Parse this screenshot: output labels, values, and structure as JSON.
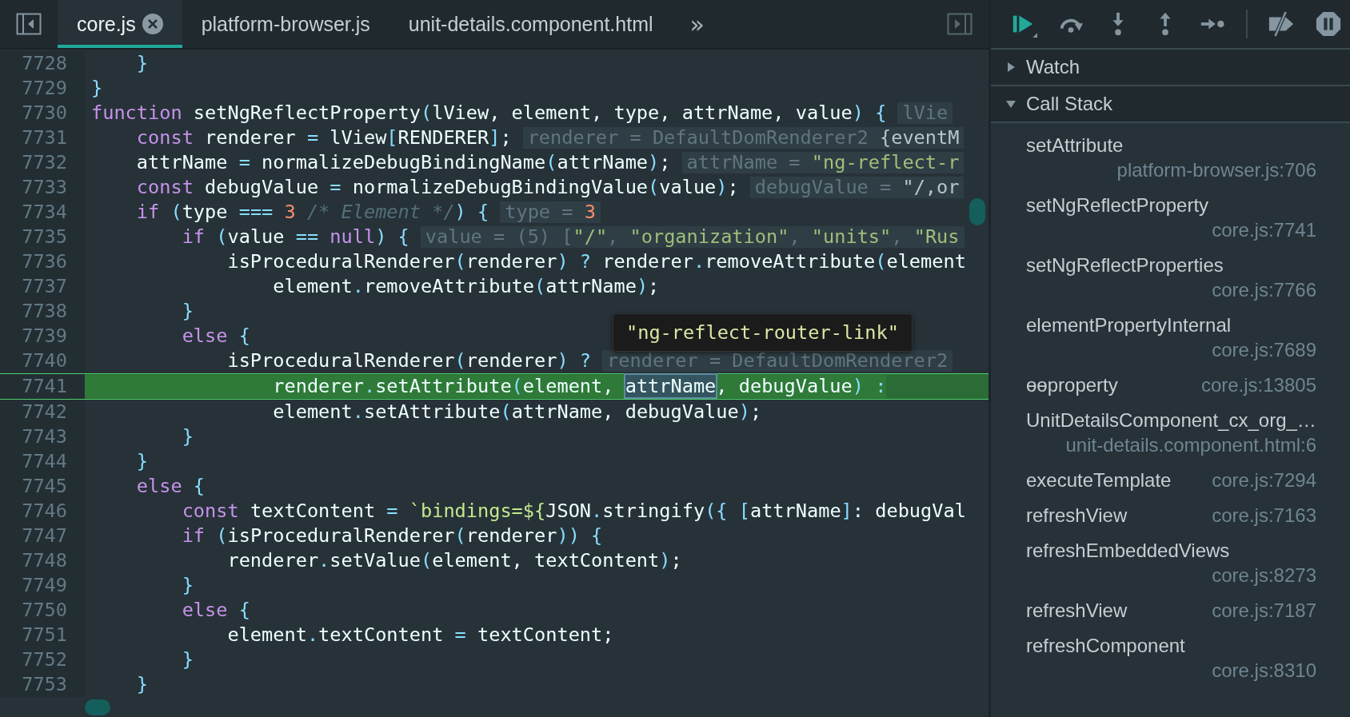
{
  "tabs": [
    {
      "label": "core.js",
      "selected": true,
      "closable": true
    },
    {
      "label": "platform-browser.js",
      "selected": false,
      "closable": false
    },
    {
      "label": "unit-details.component.html",
      "selected": false,
      "closable": false
    }
  ],
  "tabs_overflow": "»",
  "code": {
    "lines": [
      {
        "number": "7728",
        "current": false,
        "tokens": [
          {
            "kind": "punct",
            "text": "    }"
          }
        ]
      },
      {
        "number": "7729",
        "current": false,
        "tokens": [
          {
            "kind": "punct",
            "text": "}"
          }
        ]
      },
      {
        "number": "7730",
        "current": false,
        "tokens": [
          {
            "kind": "keyword",
            "text": "function"
          },
          {
            "kind": "plain",
            "text": " setNgReflectProperty"
          },
          {
            "kind": "punct",
            "text": "("
          },
          {
            "kind": "plain",
            "text": "lView, element, type, attrName, value"
          },
          {
            "kind": "punct",
            "text": ")"
          },
          {
            "kind": "punct",
            "text": " {"
          }
        ],
        "hint": [
          {
            "kind": "hint",
            "text": "lVie"
          }
        ]
      },
      {
        "number": "7731",
        "current": false,
        "tokens": [
          {
            "kind": "keyword",
            "text": "    const"
          },
          {
            "kind": "plain",
            "text": " renderer "
          },
          {
            "kind": "punct",
            "text": "="
          },
          {
            "kind": "plain",
            "text": " lView"
          },
          {
            "kind": "punct",
            "text": "["
          },
          {
            "kind": "plain",
            "text": "RENDERER"
          },
          {
            "kind": "punct",
            "text": "]"
          },
          {
            "kind": "plain",
            "text": ";"
          }
        ],
        "hint": [
          {
            "kind": "hint",
            "text": "renderer = DefaultDomRenderer2 "
          },
          {
            "kind": "plain",
            "text": "{eventM"
          }
        ]
      },
      {
        "number": "7732",
        "current": false,
        "tokens": [
          {
            "kind": "plain",
            "text": "    attrName "
          },
          {
            "kind": "punct",
            "text": "="
          },
          {
            "kind": "plain",
            "text": " normalizeDebugBindingName"
          },
          {
            "kind": "punct",
            "text": "("
          },
          {
            "kind": "plain",
            "text": "attrName"
          },
          {
            "kind": "punct",
            "text": ")"
          },
          {
            "kind": "plain",
            "text": ";"
          }
        ],
        "hint": [
          {
            "kind": "hint",
            "text": "attrName = "
          },
          {
            "kind": "string",
            "text": "\"ng-reflect-r"
          }
        ]
      },
      {
        "number": "7733",
        "current": false,
        "tokens": [
          {
            "kind": "keyword",
            "text": "    const"
          },
          {
            "kind": "plain",
            "text": " debugValue "
          },
          {
            "kind": "punct",
            "text": "="
          },
          {
            "kind": "plain",
            "text": " normalizeDebugBindingValue"
          },
          {
            "kind": "punct",
            "text": "("
          },
          {
            "kind": "plain",
            "text": "value"
          },
          {
            "kind": "punct",
            "text": ")"
          },
          {
            "kind": "plain",
            "text": ";"
          }
        ],
        "hint": [
          {
            "kind": "hint",
            "text": "debugValue = "
          },
          {
            "kind": "plain",
            "text": "\"/,or"
          }
        ]
      },
      {
        "number": "7734",
        "current": false,
        "tokens": [
          {
            "kind": "keyword",
            "text": "    if"
          },
          {
            "kind": "punct",
            "text": " ("
          },
          {
            "kind": "plain",
            "text": "type "
          },
          {
            "kind": "punct",
            "text": "==="
          },
          {
            "kind": "number",
            "text": " 3"
          },
          {
            "kind": "comment",
            "text": " /* Element */"
          },
          {
            "kind": "punct",
            "text": ")"
          },
          {
            "kind": "punct",
            "text": " {"
          }
        ],
        "hint": [
          {
            "kind": "hint",
            "text": "type = "
          },
          {
            "kind": "number",
            "text": "3"
          }
        ]
      },
      {
        "number": "7735",
        "current": false,
        "tokens": [
          {
            "kind": "keyword",
            "text": "        if"
          },
          {
            "kind": "punct",
            "text": " ("
          },
          {
            "kind": "plain",
            "text": "value "
          },
          {
            "kind": "punct",
            "text": "=="
          },
          {
            "kind": "keyword",
            "text": " null"
          },
          {
            "kind": "punct",
            "text": ")"
          },
          {
            "kind": "punct",
            "text": " {"
          }
        ],
        "hint": [
          {
            "kind": "hint",
            "text": "value = (5) ["
          },
          {
            "kind": "string",
            "text": "\"/\""
          },
          {
            "kind": "hint",
            "text": ", "
          },
          {
            "kind": "string",
            "text": "\"organization\""
          },
          {
            "kind": "hint",
            "text": ", "
          },
          {
            "kind": "string",
            "text": "\"units\""
          },
          {
            "kind": "hint",
            "text": ", "
          },
          {
            "kind": "string",
            "text": "\"Rus"
          }
        ]
      },
      {
        "number": "7736",
        "current": false,
        "tokens": [
          {
            "kind": "plain",
            "text": "            isProceduralRenderer"
          },
          {
            "kind": "punct",
            "text": "("
          },
          {
            "kind": "plain",
            "text": "renderer"
          },
          {
            "kind": "punct",
            "text": ")"
          },
          {
            "kind": "punct",
            "text": " ?"
          },
          {
            "kind": "plain",
            "text": " renderer"
          },
          {
            "kind": "punct",
            "text": "."
          },
          {
            "kind": "plain",
            "text": "removeAttribute"
          },
          {
            "kind": "punct",
            "text": "("
          },
          {
            "kind": "plain",
            "text": "element"
          }
        ]
      },
      {
        "number": "7737",
        "current": false,
        "tokens": [
          {
            "kind": "plain",
            "text": "                element"
          },
          {
            "kind": "punct",
            "text": "."
          },
          {
            "kind": "plain",
            "text": "removeAttribute"
          },
          {
            "kind": "punct",
            "text": "("
          },
          {
            "kind": "plain",
            "text": "attrName"
          },
          {
            "kind": "punct",
            "text": ")"
          },
          {
            "kind": "plain",
            "text": ";"
          }
        ]
      },
      {
        "number": "7738",
        "current": false,
        "tokens": [
          {
            "kind": "punct",
            "text": "        }"
          }
        ]
      },
      {
        "number": "7739",
        "current": false,
        "tokens": [
          {
            "kind": "keyword",
            "text": "        else"
          },
          {
            "kind": "punct",
            "text": " {"
          }
        ]
      },
      {
        "number": "7740",
        "current": false,
        "tokens": [
          {
            "kind": "plain",
            "text": "            isProceduralRenderer"
          },
          {
            "kind": "punct",
            "text": "("
          },
          {
            "kind": "plain",
            "text": "renderer"
          },
          {
            "kind": "punct",
            "text": ")"
          },
          {
            "kind": "punct",
            "text": " ?"
          }
        ],
        "hint": [
          {
            "kind": "hint",
            "text": "renderer = DefaultDomRenderer2"
          }
        ]
      },
      {
        "number": "7741",
        "current": true,
        "tokens": [
          {
            "kind": "plain",
            "text": "                renderer"
          },
          {
            "kind": "punct",
            "text": "."
          },
          {
            "kind": "plain",
            "text": "setAttribute"
          },
          {
            "kind": "punct",
            "text": "("
          },
          {
            "kind": "plain",
            "text": "element, "
          },
          {
            "kind": "match",
            "text": "attrName"
          },
          {
            "kind": "plain",
            "text": ", debugValue"
          },
          {
            "kind": "punct",
            "text": ")"
          },
          {
            "kind": "punct",
            "text": " :"
          }
        ]
      },
      {
        "number": "7742",
        "current": false,
        "tokens": [
          {
            "kind": "plain",
            "text": "                element"
          },
          {
            "kind": "punct",
            "text": "."
          },
          {
            "kind": "plain",
            "text": "setAttribute"
          },
          {
            "kind": "punct",
            "text": "("
          },
          {
            "kind": "plain",
            "text": "attrName, debugValue"
          },
          {
            "kind": "punct",
            "text": ")"
          },
          {
            "kind": "plain",
            "text": ";"
          }
        ]
      },
      {
        "number": "7743",
        "current": false,
        "tokens": [
          {
            "kind": "punct",
            "text": "        }"
          }
        ]
      },
      {
        "number": "7744",
        "current": false,
        "tokens": [
          {
            "kind": "punct",
            "text": "    }"
          }
        ]
      },
      {
        "number": "7745",
        "current": false,
        "tokens": [
          {
            "kind": "keyword",
            "text": "    else"
          },
          {
            "kind": "punct",
            "text": " {"
          }
        ]
      },
      {
        "number": "7746",
        "current": false,
        "tokens": [
          {
            "kind": "keyword",
            "text": "        const"
          },
          {
            "kind": "plain",
            "text": " textContent "
          },
          {
            "kind": "punct",
            "text": "="
          },
          {
            "kind": "string",
            "text": " `bindings=${"
          },
          {
            "kind": "plain",
            "text": "JSON"
          },
          {
            "kind": "punct",
            "text": "."
          },
          {
            "kind": "plain",
            "text": "stringify"
          },
          {
            "kind": "punct",
            "text": "({ ["
          },
          {
            "kind": "plain",
            "text": "attrName"
          },
          {
            "kind": "punct",
            "text": "]"
          },
          {
            "kind": "plain",
            "text": ": debugVal"
          }
        ]
      },
      {
        "number": "7747",
        "current": false,
        "tokens": [
          {
            "kind": "keyword",
            "text": "        if"
          },
          {
            "kind": "punct",
            "text": " ("
          },
          {
            "kind": "plain",
            "text": "isProceduralRenderer"
          },
          {
            "kind": "punct",
            "text": "("
          },
          {
            "kind": "plain",
            "text": "renderer"
          },
          {
            "kind": "punct",
            "text": "))"
          },
          {
            "kind": "punct",
            "text": " {"
          }
        ]
      },
      {
        "number": "7748",
        "current": false,
        "tokens": [
          {
            "kind": "plain",
            "text": "            renderer"
          },
          {
            "kind": "punct",
            "text": "."
          },
          {
            "kind": "plain",
            "text": "setValue"
          },
          {
            "kind": "punct",
            "text": "("
          },
          {
            "kind": "plain",
            "text": "element, textContent"
          },
          {
            "kind": "punct",
            "text": ")"
          },
          {
            "kind": "plain",
            "text": ";"
          }
        ]
      },
      {
        "number": "7749",
        "current": false,
        "tokens": [
          {
            "kind": "punct",
            "text": "        }"
          }
        ]
      },
      {
        "number": "7750",
        "current": false,
        "tokens": [
          {
            "kind": "keyword",
            "text": "        else"
          },
          {
            "kind": "punct",
            "text": " {"
          }
        ]
      },
      {
        "number": "7751",
        "current": false,
        "tokens": [
          {
            "kind": "plain",
            "text": "            element"
          },
          {
            "kind": "punct",
            "text": "."
          },
          {
            "kind": "plain",
            "text": "textContent "
          },
          {
            "kind": "punct",
            "text": "="
          },
          {
            "kind": "plain",
            "text": " textContent;"
          }
        ]
      },
      {
        "number": "7752",
        "current": false,
        "tokens": [
          {
            "kind": "punct",
            "text": "        }"
          }
        ]
      },
      {
        "number": "7753",
        "current": false,
        "tokens": [
          {
            "kind": "punct",
            "text": "    }"
          }
        ]
      }
    ],
    "tooltip": "\"ng-reflect-router-link\""
  },
  "debugger": {
    "toolbar": [
      {
        "kind": "resume"
      },
      {
        "kind": "step-over"
      },
      {
        "kind": "step-into"
      },
      {
        "kind": "step-out"
      },
      {
        "kind": "step"
      },
      {
        "kind": "divider"
      },
      {
        "kind": "deactivate"
      },
      {
        "kind": "pause-exceptions"
      }
    ],
    "sections": [
      {
        "title": "Watch",
        "expanded": false
      },
      {
        "title": "Call Stack",
        "expanded": true
      }
    ],
    "call_stack": [
      {
        "name": "setAttribute",
        "location": "platform-browser.js:706"
      },
      {
        "name": "setNgReflectProperty",
        "location": "core.js:7741"
      },
      {
        "name": "setNgReflectProperties",
        "location": "core.js:7766"
      },
      {
        "name": "elementPropertyInternal",
        "location": "core.js:7689"
      },
      {
        "name": "ɵɵproperty",
        "location": "core.js:13805"
      },
      {
        "name": "UnitDetailsComponent_cx_org_…",
        "location": "unit-details.component.html:6"
      },
      {
        "name": "executeTemplate",
        "location": "core.js:7294"
      },
      {
        "name": "refreshView",
        "location": "core.js:7163"
      },
      {
        "name": "refreshEmbeddedViews",
        "location": "core.js:8273"
      },
      {
        "name": "refreshView",
        "location": "core.js:7187"
      },
      {
        "name": "refreshComponent",
        "location": "core.js:8310"
      }
    ]
  }
}
